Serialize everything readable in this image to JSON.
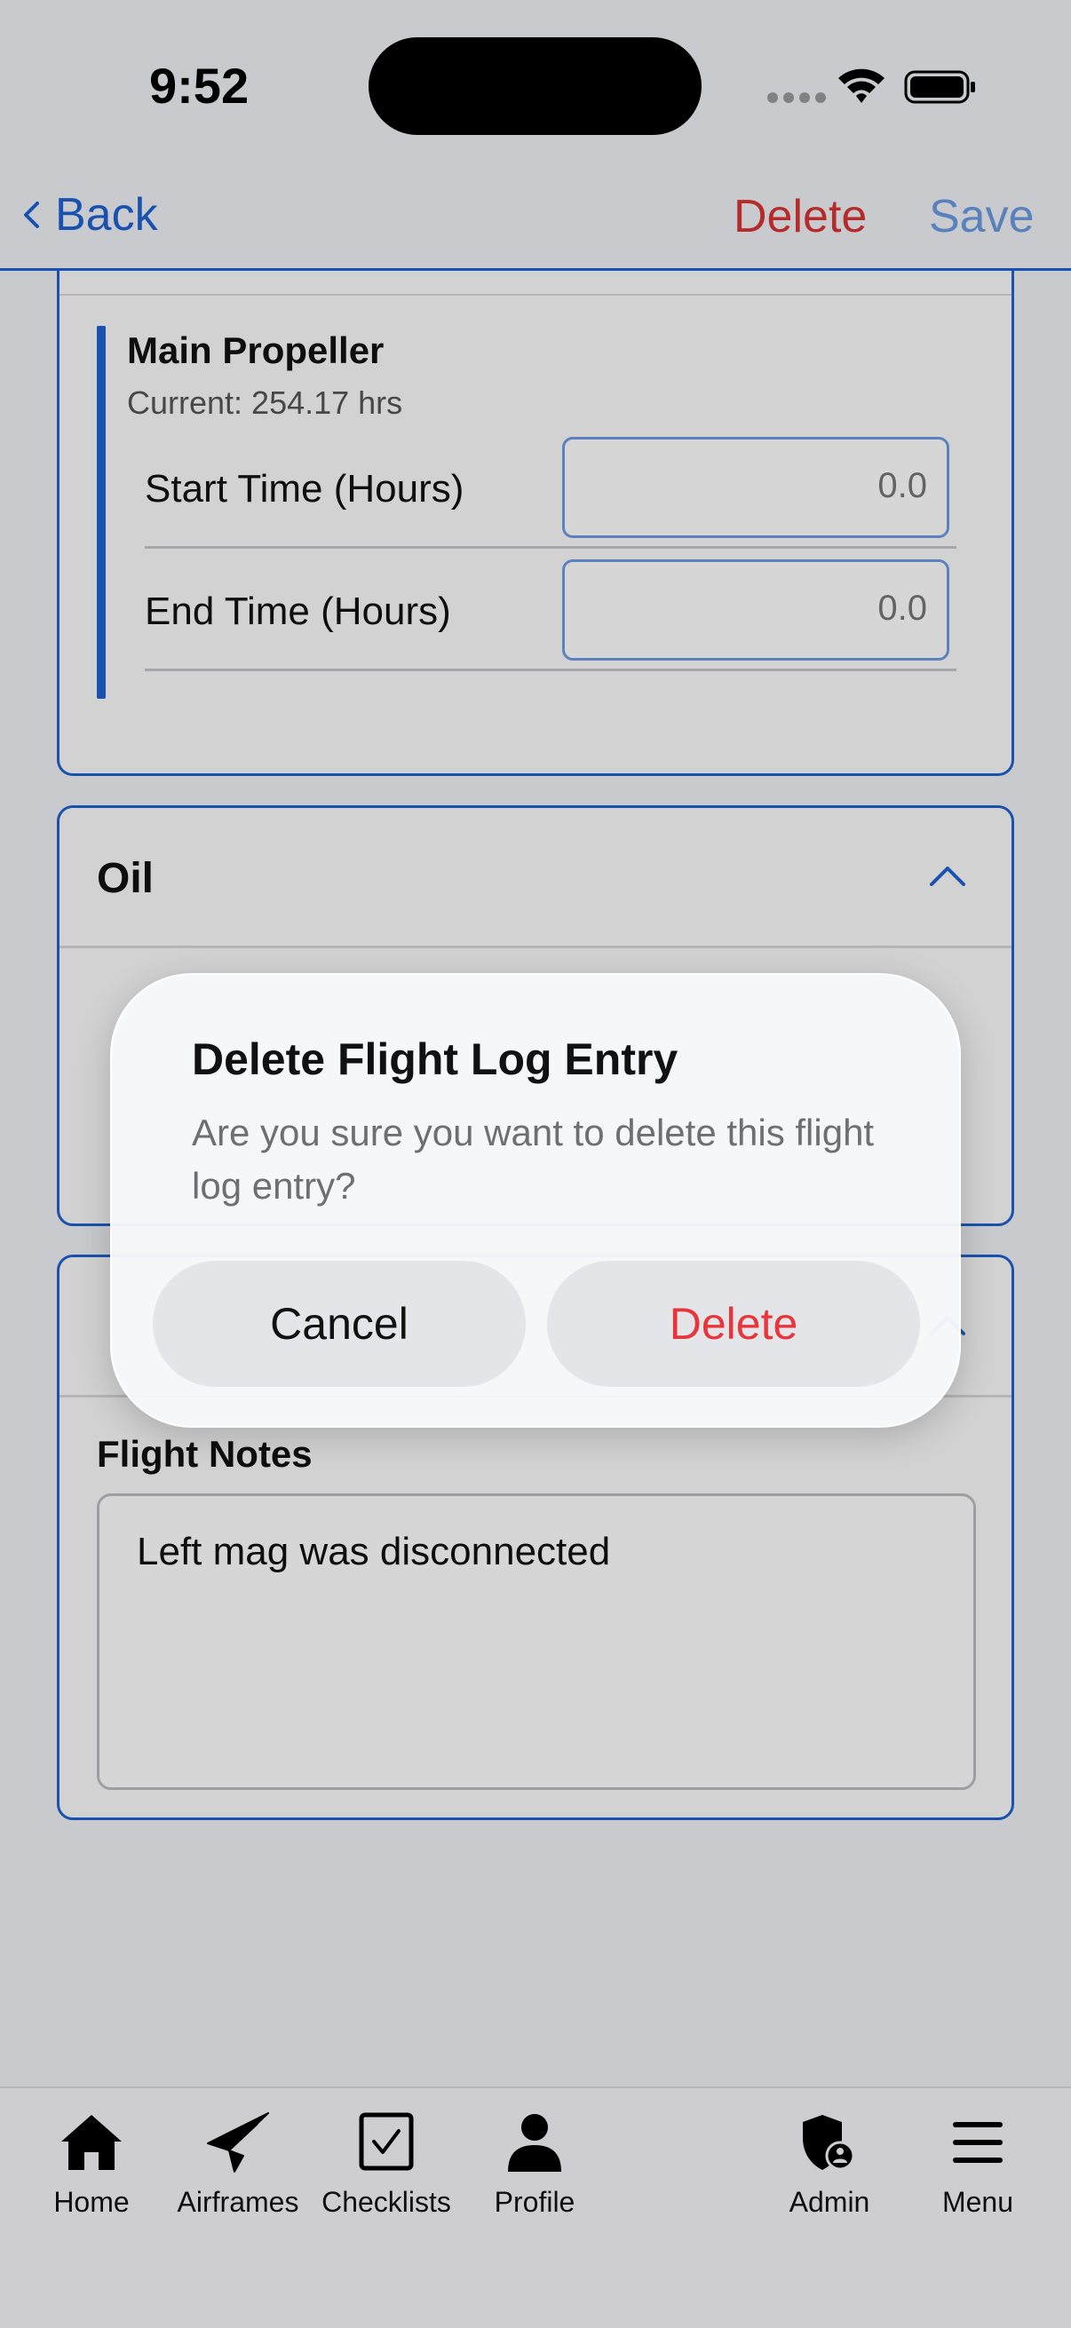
{
  "status_bar": {
    "time": "9:52"
  },
  "nav": {
    "back_label": "Back",
    "delete_label": "Delete",
    "save_label": "Save"
  },
  "propeller": {
    "title": "Main Propeller",
    "current": "Current: 254.17 hrs",
    "start_label": "Start Time (Hours)",
    "start_placeholder": "0.0",
    "end_label": "End Time (Hours)",
    "end_placeholder": "0.0"
  },
  "oil": {
    "title": "Oil"
  },
  "notes": {
    "field_label": "Flight Notes",
    "value": "Left mag was disconnected"
  },
  "dialog": {
    "title": "Delete Flight Log Entry",
    "message": "Are you sure you want to delete this flight log entry?",
    "cancel_label": "Cancel",
    "delete_label": "Delete"
  },
  "tabs": [
    {
      "label": "Home",
      "icon": "home-icon"
    },
    {
      "label": "Airframes",
      "icon": "paper-plane-icon"
    },
    {
      "label": "Checklists",
      "icon": "checkbox-icon"
    },
    {
      "label": "Profile",
      "icon": "person-icon"
    },
    {
      "label": "Admin",
      "icon": "shield-user-icon"
    },
    {
      "label": "Menu",
      "icon": "hamburger-icon"
    }
  ],
  "colors": {
    "accent": "#1e62d0",
    "danger": "#d83434",
    "save": "#6a9ae0"
  }
}
